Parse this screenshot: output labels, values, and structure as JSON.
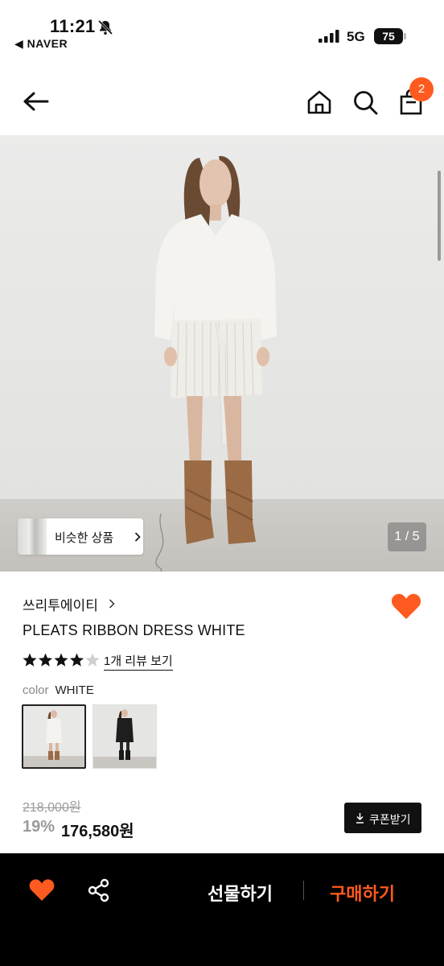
{
  "status_bar": {
    "time": "11:21",
    "back_app": "◀ NAVER",
    "network": "5G",
    "battery": "75"
  },
  "header": {
    "cart_count": "2"
  },
  "gallery": {
    "similar_label": "비슷한 상품",
    "pager": "1 / 5"
  },
  "product": {
    "brand": "쓰리투에이티",
    "name": "PLEATS RIBBON DRESS WHITE",
    "rating_stars": 4,
    "review_link": "1개 리뷰 보기",
    "color_key": "color",
    "color_value": "WHITE",
    "original_price": "218,000원",
    "discount": "19%",
    "price": "176,580원",
    "coupon_label": "쿠폰받기"
  },
  "bottom_bar": {
    "gift_label": "선물하기",
    "buy_label": "구매하기"
  },
  "colors": {
    "accent": "#ff5a1f",
    "bar_bg": "#000000"
  }
}
